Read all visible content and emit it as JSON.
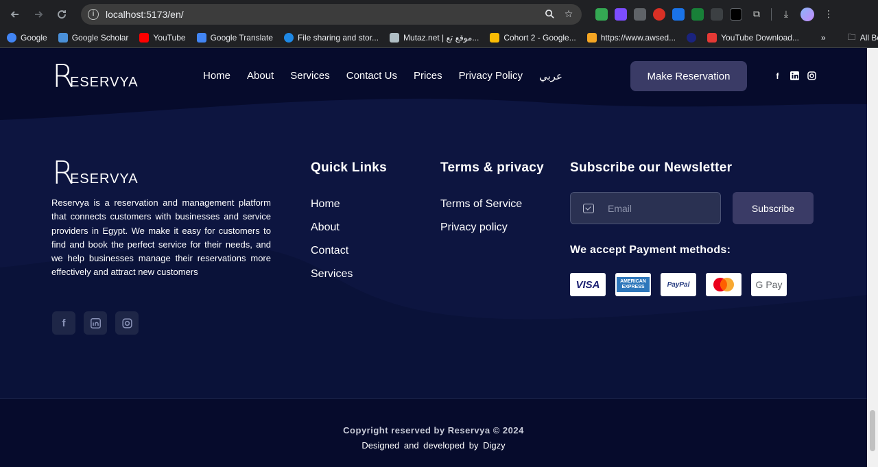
{
  "browser": {
    "url": "localhost:5173/en/",
    "bookmarks": [
      {
        "label": "Google",
        "color": "#4285f4"
      },
      {
        "label": "Google Scholar",
        "color": "#4a90d9"
      },
      {
        "label": "YouTube",
        "color": "#ff0000"
      },
      {
        "label": "Google Translate",
        "color": "#4285f4"
      },
      {
        "label": "File sharing and stor...",
        "color": "#1e88e5"
      },
      {
        "label": "Mutaz.net | موقع تع...",
        "color": "#b0bec5"
      },
      {
        "label": "Cohort 2 - Google...",
        "color": "#fbbc04"
      },
      {
        "label": "https://www.awsed...",
        "color": "#f5a623"
      },
      {
        "label": "",
        "color": "#1a237e"
      },
      {
        "label": "YouTube Download...",
        "color": "#e53935"
      }
    ],
    "overflow": "»",
    "all_bookmarks": "All Bookmarks"
  },
  "nav": {
    "brand_r": "R",
    "brand_rest": "ESERVYA",
    "links": [
      "Home",
      "About",
      "Services",
      "Contact Us",
      "Prices",
      "Privacy Policy",
      "عربي"
    ],
    "cta": "Make Reservation"
  },
  "footer": {
    "about": "Reservya is a reservation and management platform that connects customers with businesses and service providers in Egypt. We make it easy for customers to find and book the perfect service for their needs, and we help businesses manage their reservations more effectively and attract new customers",
    "quick_links_title": "Quick Links",
    "quick_links": [
      "Home",
      "About",
      "Contact",
      "Services"
    ],
    "terms_title": "Terms & privacy",
    "terms_links": [
      "Terms of Service",
      "Privacy policy"
    ],
    "newsletter_title": "Subscribe our Newsletter",
    "email_placeholder": "Email",
    "subscribe": "Subscribe",
    "payment_title": "We accept Payment methods:",
    "payments": [
      "VISA",
      "AMERICAN EXPRESS",
      "PayPal",
      "Mastercard",
      "G Pay"
    ],
    "copyright": "Copyright reserved by Reservya © 2024",
    "credits": "Designed and developed by Digzy"
  },
  "colors": {
    "page_bg": "#060b2c",
    "button_bg": "#3a3b66"
  }
}
